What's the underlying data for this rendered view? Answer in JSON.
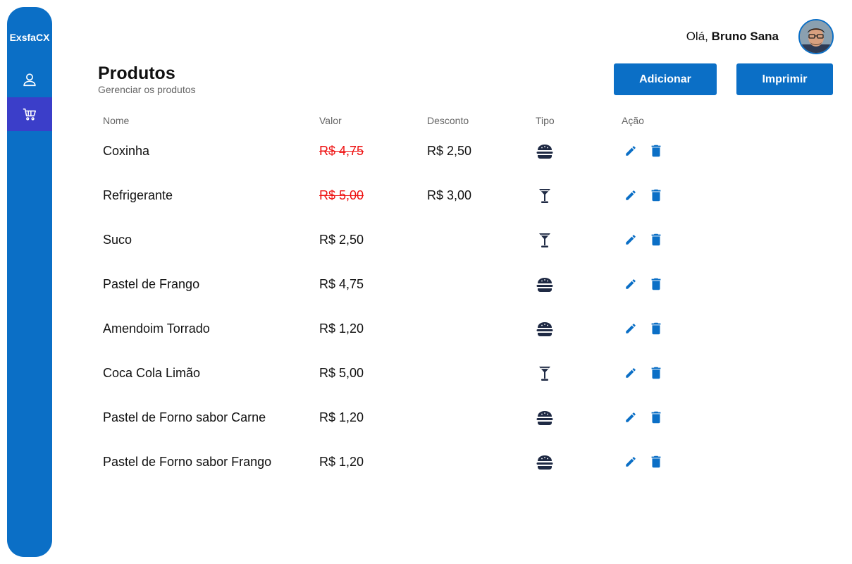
{
  "brand": "ExsfaCX",
  "sidebar": {
    "items": [
      {
        "icon": "user-icon",
        "active": false
      },
      {
        "icon": "cart-icon",
        "active": true
      }
    ]
  },
  "header": {
    "greeting_prefix": "Olá, ",
    "user_name": "Bruno Sana"
  },
  "page": {
    "title": "Produtos",
    "subtitle": "Gerenciar os produtos"
  },
  "actions": {
    "add_label": "Adicionar",
    "print_label": "Imprimir"
  },
  "table": {
    "headers": {
      "name": "Nome",
      "value": "Valor",
      "discount": "Desconto",
      "type": "Tipo",
      "action": "Ação"
    },
    "rows": [
      {
        "name": "Coxinha",
        "value": "R$ 4,75",
        "discount": "R$ 2,50",
        "type": "burger-icon"
      },
      {
        "name": "Refrigerante",
        "value": "R$ 5,00",
        "discount": "R$ 3,00",
        "type": "cocktail-icon"
      },
      {
        "name": "Suco",
        "value": "R$ 2,50",
        "discount": "",
        "type": "cocktail-icon"
      },
      {
        "name": "Pastel de Frango",
        "value": "R$ 4,75",
        "discount": "",
        "type": "burger-icon"
      },
      {
        "name": "Amendoim Torrado",
        "value": "R$ 1,20",
        "discount": "",
        "type": "burger-icon"
      },
      {
        "name": "Coca Cola Limão",
        "value": "R$ 5,00",
        "discount": "",
        "type": "cocktail-icon"
      },
      {
        "name": "Pastel de Forno sabor Carne",
        "value": "R$ 1,20",
        "discount": "",
        "type": "burger-icon"
      },
      {
        "name": "Pastel de Forno sabor Frango",
        "value": "R$ 1,20",
        "discount": "",
        "type": "burger-icon"
      }
    ]
  },
  "colors": {
    "primary": "#0b6fc6",
    "active_nav": "#3b3ec9",
    "strike_price": "#e11111",
    "type_icon": "#1f2a44"
  }
}
